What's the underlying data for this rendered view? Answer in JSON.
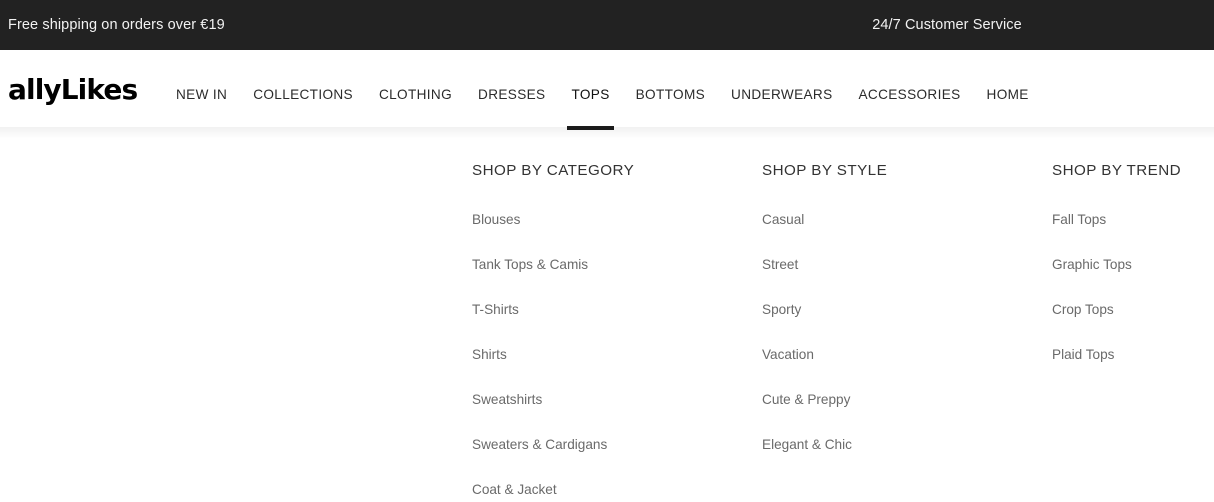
{
  "announcement": {
    "left_text": "Free shipping on orders over €19",
    "center_text": "24/7 Customer Service",
    "background": "#222222",
    "text_color": "#f2f2f2"
  },
  "header": {
    "logo_text": "allyLikes",
    "logo_color": "#000000",
    "nav": [
      {
        "label": "NEW IN",
        "active": false
      },
      {
        "label": "COLLECTIONS",
        "active": false
      },
      {
        "label": "CLOTHING",
        "active": false
      },
      {
        "label": "DRESSES",
        "active": false
      },
      {
        "label": "TOPS",
        "active": true
      },
      {
        "label": "BOTTOMS",
        "active": false
      },
      {
        "label": "UNDERWEARS",
        "active": false
      },
      {
        "label": "ACCESSORIES",
        "active": false
      },
      {
        "label": "HOME",
        "active": false
      }
    ],
    "active_indicator_color": "#1c1c1c"
  },
  "mega_menu": {
    "open_for": "TOPS",
    "heading_color": "#333333",
    "link_color": "#6a6a6a",
    "columns": [
      {
        "heading": "SHOP BY CATEGORY",
        "links": [
          "Blouses",
          "Tank Tops & Camis",
          "T-Shirts",
          "Shirts",
          "Sweatshirts",
          "Sweaters & Cardigans",
          "Coat & Jacket"
        ]
      },
      {
        "heading": "SHOP BY STYLE",
        "links": [
          "Casual",
          "Street",
          "Sporty",
          "Vacation",
          "Cute & Preppy",
          "Elegant & Chic"
        ]
      },
      {
        "heading": "SHOP BY TREND",
        "links": [
          "Fall Tops",
          "Graphic Tops",
          "Crop Tops",
          "Plaid Tops"
        ]
      }
    ]
  }
}
